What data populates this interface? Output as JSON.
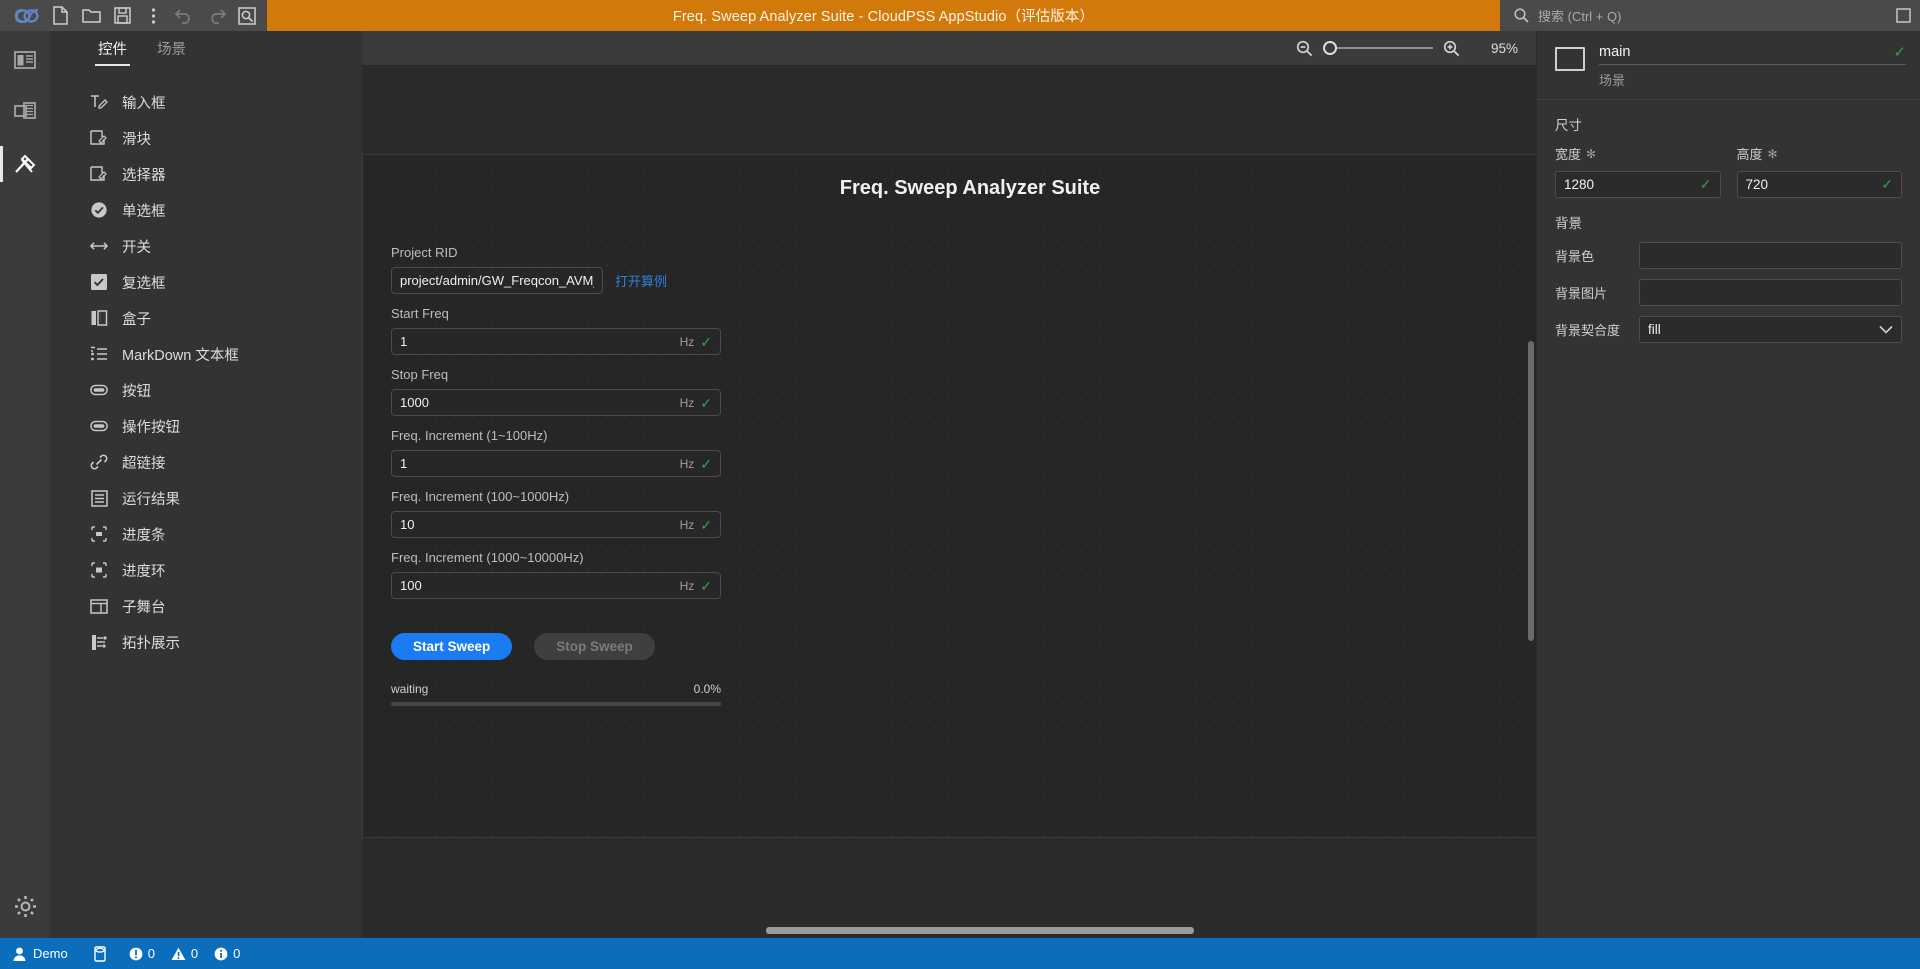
{
  "titlebar": {
    "title": "Freq. Sweep Analyzer Suite - CloudPSS AppStudio（评估版本）",
    "logo_icon": "cloudpss-logo-icon",
    "tools": [
      {
        "name": "new-file-button",
        "icon": "new-file-icon",
        "enabled": true
      },
      {
        "name": "open-folder-button",
        "icon": "open-folder-icon",
        "enabled": true
      },
      {
        "name": "save-button",
        "icon": "save-disk-icon",
        "enabled": true
      },
      {
        "name": "more-options-button",
        "icon": "vertical-dots-icon",
        "enabled": true
      },
      {
        "name": "undo-button",
        "icon": "undo-arrow-icon",
        "enabled": false
      },
      {
        "name": "redo-button",
        "icon": "redo-arrow-icon",
        "enabled": false
      },
      {
        "name": "preview-button",
        "icon": "magnifier-box-icon",
        "enabled": true
      }
    ],
    "search_placeholder": "搜索 (Ctrl + Q)",
    "search_icon": "search-icon",
    "window_button_icon": "maximize-restore-icon"
  },
  "rail": {
    "items": [
      {
        "name": "sidebar-rail-layout",
        "icon": "panel-layout-icon",
        "active": false
      },
      {
        "name": "sidebar-rail-scenes",
        "icon": "film-frames-icon",
        "active": false
      },
      {
        "name": "sidebar-rail-widgets",
        "icon": "tools-hammer-icon",
        "active": true
      }
    ],
    "bottom": {
      "name": "sidebar-rail-settings",
      "icon": "gear-icon"
    }
  },
  "palette": {
    "tabs": [
      {
        "label": "控件",
        "active": true
      },
      {
        "label": "场景",
        "active": false
      }
    ],
    "items": [
      {
        "label": "输入框",
        "icon": "text-input-icon"
      },
      {
        "label": "滑块",
        "icon": "slider-icon"
      },
      {
        "label": "选择器",
        "icon": "selector-icon"
      },
      {
        "label": "单选框",
        "icon": "radio-checked-icon"
      },
      {
        "label": "开关",
        "icon": "switch-arrows-icon"
      },
      {
        "label": "复选框",
        "icon": "checkbox-checked-icon"
      },
      {
        "label": "盒子",
        "icon": "box-columns-icon"
      },
      {
        "label": "MarkDown 文本框",
        "icon": "markdown-list-icon"
      },
      {
        "label": "按钮",
        "icon": "pill-button-icon"
      },
      {
        "label": "操作按钮",
        "icon": "pill-button-icon"
      },
      {
        "label": "超链接",
        "icon": "link-chain-icon"
      },
      {
        "label": "运行结果",
        "icon": "results-lines-icon"
      },
      {
        "label": "进度条",
        "icon": "progress-bar-icon"
      },
      {
        "label": "进度环",
        "icon": "progress-ring-icon"
      },
      {
        "label": "子舞台",
        "icon": "sub-stage-window-icon"
      },
      {
        "label": "拓扑展示",
        "icon": "topology-icon"
      }
    ]
  },
  "canvas": {
    "zoom_out_icon": "zoom-out-icon",
    "zoom_in_icon": "zoom-in-icon",
    "zoom_percent": "95%",
    "stage": {
      "title": "Freq. Sweep Analyzer Suite",
      "fields": [
        {
          "label": "Project RID",
          "value": "project/admin/GW_Freqcon_AVM_Fi...",
          "suffix": "",
          "valid": false,
          "link": "打开算例"
        },
        {
          "label": "Start Freq",
          "value": "1",
          "suffix": "Hz",
          "valid": true
        },
        {
          "label": "Stop Freq",
          "value": "1000",
          "suffix": "Hz",
          "valid": true
        },
        {
          "label": "Freq. Increment (1~100Hz)",
          "value": "1",
          "suffix": "Hz",
          "valid": true
        },
        {
          "label": "Freq. Increment (100~1000Hz)",
          "value": "10",
          "suffix": "Hz",
          "valid": true
        },
        {
          "label": "Freq. Increment (1000~10000Hz)",
          "value": "100",
          "suffix": "Hz",
          "valid": true
        }
      ],
      "start_button": "Start Sweep",
      "stop_button": "Stop Sweep",
      "progress_status": "waiting",
      "progress_percent": "0.0%",
      "progress_value": 0
    }
  },
  "props": {
    "name": "main",
    "type": "场景",
    "thumb_icon": "scene-frame-icon",
    "name_valid_icon": "check-icon",
    "size_section": "尺寸",
    "width_label": "宽度",
    "width_value": "1280",
    "height_label": "高度",
    "height_value": "720",
    "required_mark": "✻",
    "background_section": "背景",
    "bg_color_label": "背景色",
    "bg_color_value": "",
    "bg_image_label": "背景图片",
    "bg_image_value": "",
    "bg_fit_label": "背景契合度",
    "bg_fit_value": "fill",
    "chevron_icon": "chevron-down-icon"
  },
  "statusbar": {
    "user": "Demo",
    "user_icon": "user-icon",
    "db_icon": "database-icon",
    "counts": [
      {
        "icon": "error-circle-icon",
        "value": "0"
      },
      {
        "icon": "warning-triangle-icon",
        "value": "0"
      },
      {
        "icon": "info-circle-icon",
        "value": "0"
      }
    ]
  },
  "colors": {
    "accent_orange": "#d2790c",
    "accent_blue": "#1a7cf0",
    "status_blue": "#0a6ebd",
    "valid_green": "#2aa84a",
    "link_blue": "#2f7fe0"
  }
}
